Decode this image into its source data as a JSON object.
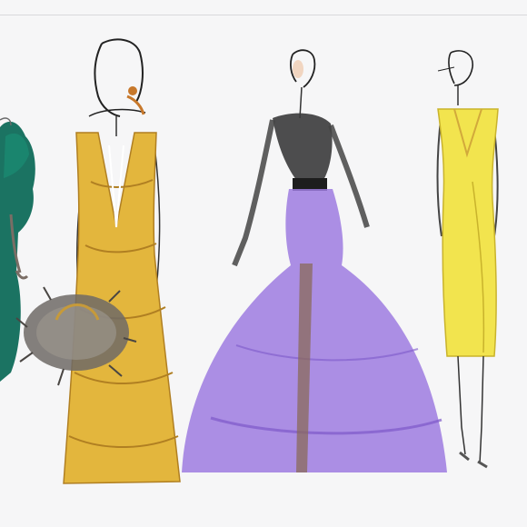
{
  "scene": {
    "background": "#f6f6f7",
    "figures": [
      {
        "name": "green-gown-figure",
        "dress_color": "#0f6b5a"
      },
      {
        "name": "yellow-ruffle-gown-figure",
        "dress_color": "#e3b63d",
        "accessory": "feather-clutch"
      },
      {
        "name": "lilac-ballgown-figure",
        "dress_color": "#9e7be0",
        "top_color": "#3b3b3b"
      },
      {
        "name": "yellow-slip-dress-figure",
        "dress_color": "#f2e44e"
      }
    ]
  }
}
